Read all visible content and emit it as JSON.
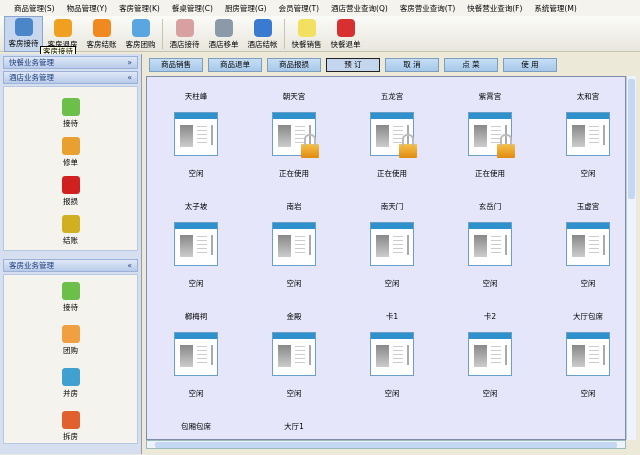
{
  "menu": [
    "商品管理(S)",
    "物品管理(Y)",
    "客房管理(K)",
    "餐桌管理(C)",
    "厨房管理(G)",
    "会员管理(T)",
    "酒店营业查询(Q)",
    "客房营业查询(T)",
    "快餐营业查询(F)",
    "系统管理(M)"
  ],
  "toolbar": [
    {
      "label": "客房接待",
      "color": "#4a86c8"
    },
    {
      "label": "客房退房",
      "color": "#f0a020"
    },
    {
      "label": "客房结账",
      "color": "#f08a20"
    },
    {
      "label": "客房团购",
      "color": "#5aa6e0"
    },
    {
      "label": "酒店接待",
      "color": "#d8a0a0"
    },
    {
      "label": "酒店移单",
      "color": "#8a9aa8"
    },
    {
      "label": "酒店结帐",
      "color": "#3a7ad0"
    },
    {
      "label": "快餐销售",
      "color": "#f2e060"
    },
    {
      "label": "快餐退单",
      "color": "#d83030"
    }
  ],
  "tooltip": "客房接待",
  "left": {
    "panel1": {
      "title": "快餐业务管理",
      "chev": "»"
    },
    "panel2": {
      "title": "酒店业务管理",
      "chev": "«",
      "items": [
        {
          "label": "接待",
          "color": "#6cc04a"
        },
        {
          "label": "修单",
          "color": "#e8a030"
        },
        {
          "label": "报损",
          "color": "#d02020"
        },
        {
          "label": "结账",
          "color": "#d0b020"
        }
      ]
    },
    "panel3": {
      "title": "客房业务管理",
      "chev": "«",
      "items": [
        {
          "label": "接待",
          "color": "#6cc04a"
        },
        {
          "label": "团购",
          "color": "#f0a040"
        },
        {
          "label": "并房",
          "color": "#40a0d0"
        },
        {
          "label": "拆房",
          "color": "#e06030"
        }
      ]
    }
  },
  "buttons": [
    "商品销售",
    "商品退单",
    "商品报损",
    "预 订",
    "取 消",
    "点 菜",
    "使 用"
  ],
  "rooms": [
    {
      "name": "天柱峰",
      "status": "空闲",
      "locked": false
    },
    {
      "name": "朝天宫",
      "status": "正在使用",
      "locked": true
    },
    {
      "name": "五龙宫",
      "status": "正在使用",
      "locked": true
    },
    {
      "name": "紫霄宫",
      "status": "正在使用",
      "locked": true
    },
    {
      "name": "太和宫",
      "status": "空闲",
      "locked": false
    },
    {
      "name": "太子坡",
      "status": "空闲",
      "locked": false
    },
    {
      "name": "南岩",
      "status": "空闲",
      "locked": false
    },
    {
      "name": "南天门",
      "status": "空闲",
      "locked": false
    },
    {
      "name": "玄岳门",
      "status": "空闲",
      "locked": false
    },
    {
      "name": "玉虚宫",
      "status": "空闲",
      "locked": false
    },
    {
      "name": "榔梅祠",
      "status": "空闲",
      "locked": false
    },
    {
      "name": "金殿",
      "status": "空闲",
      "locked": false
    },
    {
      "name": "卡1",
      "status": "空闲",
      "locked": false
    },
    {
      "name": "卡2",
      "status": "空闲",
      "locked": false
    },
    {
      "name": "大厅包席",
      "status": "空闲",
      "locked": false
    },
    {
      "name": "包厢包席",
      "status": "",
      "locked": false
    },
    {
      "name": "大厅1",
      "status": "",
      "locked": false
    }
  ]
}
